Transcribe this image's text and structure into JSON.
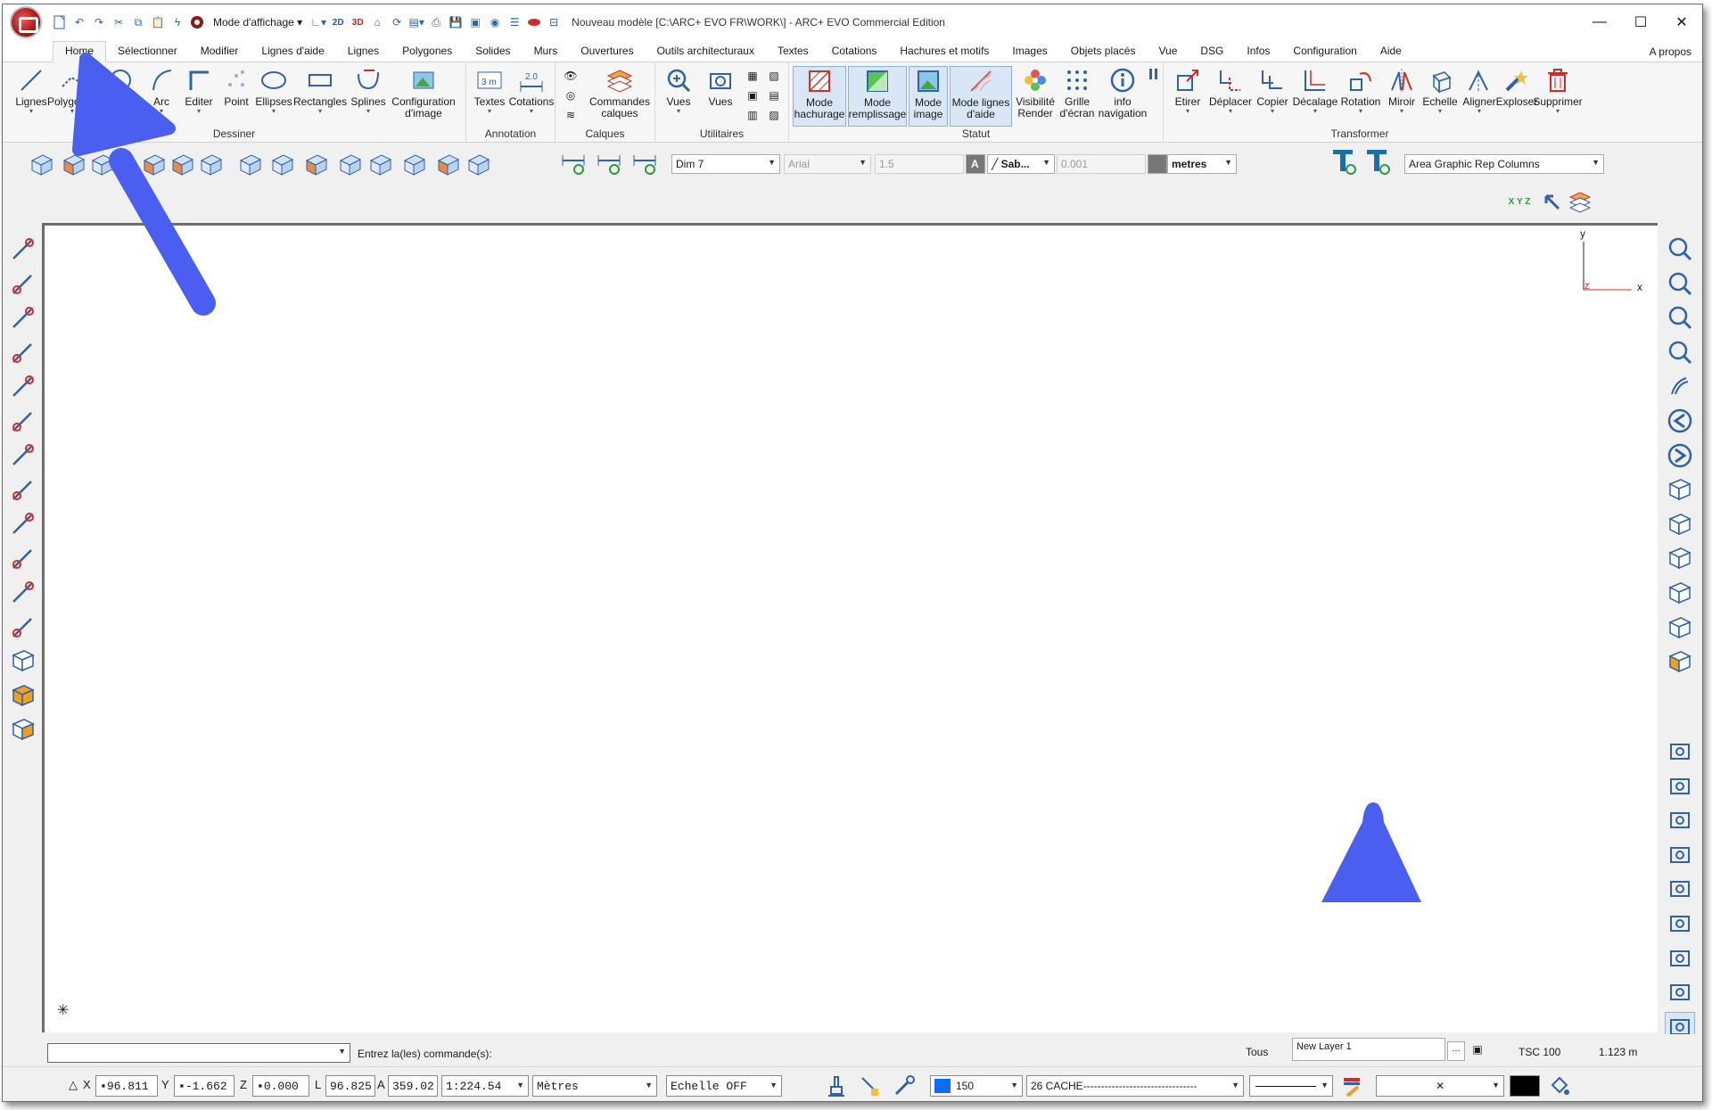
{
  "titlebar": {
    "display_mode": "Mode d'affichage",
    "btn_2d": "2D",
    "btn_3d": "3D",
    "title": "Nouveau modèle [C:\\ARC+ EVO FR\\WORK\\] - ARC+ EVO Commercial Edition",
    "minimize": "—",
    "maximize": "☐",
    "close": "✕"
  },
  "tabs": [
    "Home",
    "Sélectionner",
    "Modifier",
    "Lignes d'aide",
    "Lignes",
    "Polygones",
    "Solides",
    "Murs",
    "Ouvertures",
    "Outils architecturaux",
    "Textes",
    "Cotations",
    "Hachures et motifs",
    "Images",
    "Objets placés",
    "Vue",
    "DSG",
    "Infos",
    "Configuration",
    "Aide"
  ],
  "apropos": "A propos",
  "ribbon": {
    "dessiner": {
      "label": "Dessiner",
      "buttons": [
        "Lignes",
        "Polygones",
        "Cercles",
        "Arc",
        "Editer",
        "Point",
        "Ellipses",
        "Rectangles",
        "Splines",
        "Configuration\nd'image"
      ]
    },
    "annotation": {
      "label": "Annotation",
      "buttons": [
        "Textes",
        "Cotations"
      ]
    },
    "calques": {
      "label": "Calques",
      "buttons": [
        "Commandes\ncalques"
      ]
    },
    "utilitaires": {
      "label": "Utilitaires",
      "buttons": [
        "Vues",
        "Vues"
      ]
    },
    "statut": {
      "label": "Statut",
      "buttons": [
        "Mode\nhachurage",
        "Mode\nremplissage",
        "Mode\nimage",
        "Mode lignes\nd'aide",
        "Visibilité\nRender",
        "Grille\nd'écran",
        "info\nnavigation"
      ]
    },
    "transformer": {
      "label": "Transformer",
      "buttons": [
        "Etirer",
        "Déplacer",
        "Copier",
        "Décalage",
        "Rotation",
        "Miroir",
        "Echelle",
        "Aligner",
        "Exploser",
        "Supprimer"
      ]
    }
  },
  "toolbar2": {
    "dim_style": "Dim 7",
    "font": "Arial",
    "text_height": "1.5",
    "text_style_a": "A",
    "line_style": "Sab...",
    "tolerance": "0.001",
    "units": "metres",
    "area_columns": "Area Graphic Rep Columns",
    "xyz_label": "X Y Z"
  },
  "canvas": {
    "axis_y": "y",
    "axis_x": "x",
    "axis_z": "z",
    "origin_mark": "✳"
  },
  "command": {
    "prompt": "Entrez la(les) commande(s):",
    "input_value": "",
    "layer_scope": "Tous",
    "layer_name": "New Layer 1",
    "tsc": "TSC 100",
    "distance": "1.123 m"
  },
  "status": {
    "x_label": "X",
    "x_value": "96.811",
    "y_label": "Y",
    "y_value": "-1.662",
    "z_label": "Z",
    "z_value": "0.000",
    "l_label": "L",
    "l_value": "96.825",
    "a_label": "A",
    "a_value": "359.02",
    "scale": "1:224.54",
    "units": "Mètres",
    "echelle": "Echelle OFF",
    "color_index": "150",
    "line_type": "26 CACHE--------------------------------",
    "hatch_value": "✕"
  },
  "colors": {
    "accent_blue": "#2f62a8",
    "arrow_blue": "#4a5ff0",
    "icon_red": "#d22b2b",
    "icon_orange": "#e07b1a"
  }
}
